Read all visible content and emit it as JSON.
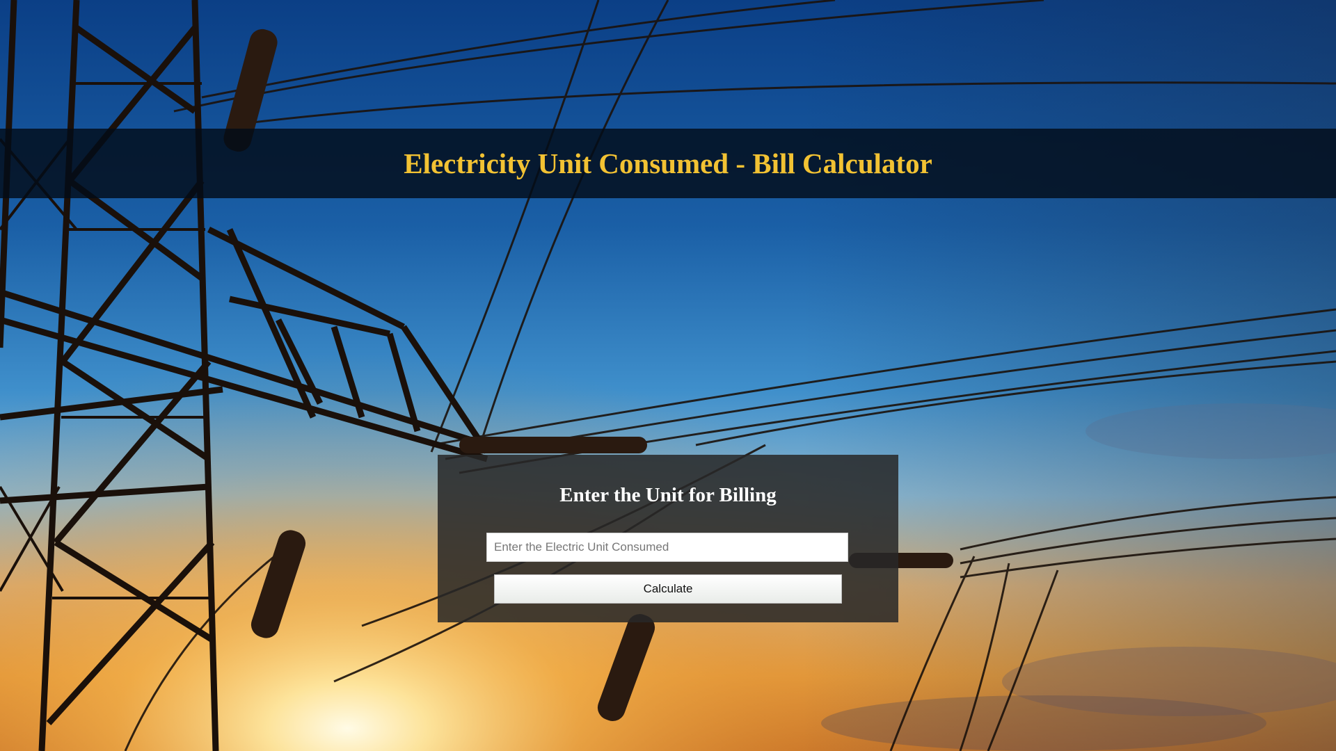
{
  "header": {
    "title": "Electricity Unit Consumed - Bill Calculator"
  },
  "form": {
    "title": "Enter the Unit for Billing",
    "input_placeholder": "Enter the Electric Unit Consumed",
    "input_value": "",
    "button_label": "Calculate"
  },
  "background": {
    "icon": "power-transmission-tower-sunset-photo"
  },
  "colors": {
    "title_accent": "#f2c233",
    "header_band": "#020c18",
    "panel": "#282828"
  }
}
